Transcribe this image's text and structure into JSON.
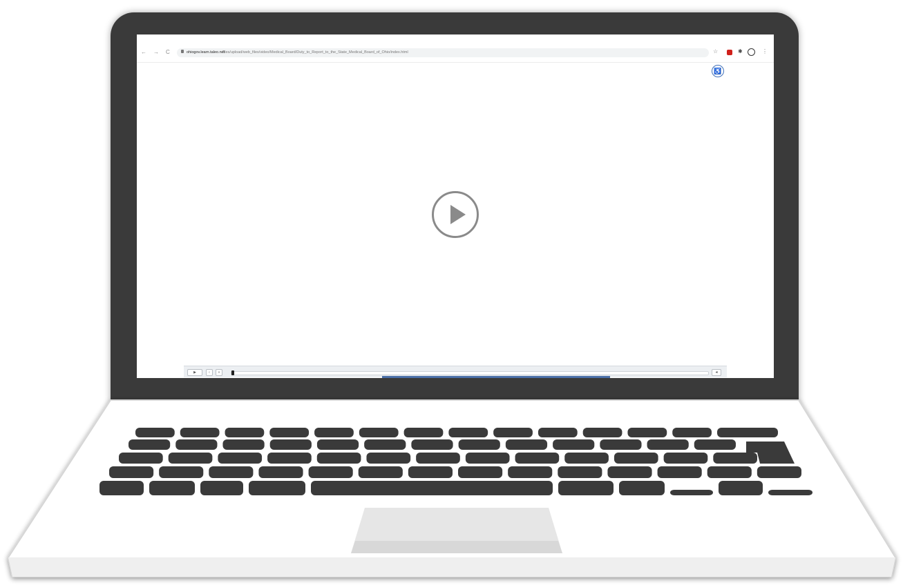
{
  "browser": {
    "url_host": "ohiogov.learn.taleo.net",
    "url_path": "/files/upload/web_files/video/Medical_Board/Duty_to_Report_to_the_State_Medical_Board_of_Ohio/index.html",
    "nav": {
      "back_icon": "←",
      "forward_icon": "→",
      "reload_icon": "C"
    },
    "icons": {
      "star": "☆",
      "puzzle": "✱",
      "menu": "⋮"
    }
  },
  "player": {
    "accessibility_icon": "♿",
    "play_label": "▶",
    "rewind_label": "‹",
    "replay_label": "«",
    "volume_label": "◂",
    "progress": 0.0
  },
  "colors": {
    "bezel": "#3a3a3a",
    "key": "#3a3a3a",
    "ext_red": "#d0201b",
    "accessibility_blue": "#3f6fb8"
  }
}
